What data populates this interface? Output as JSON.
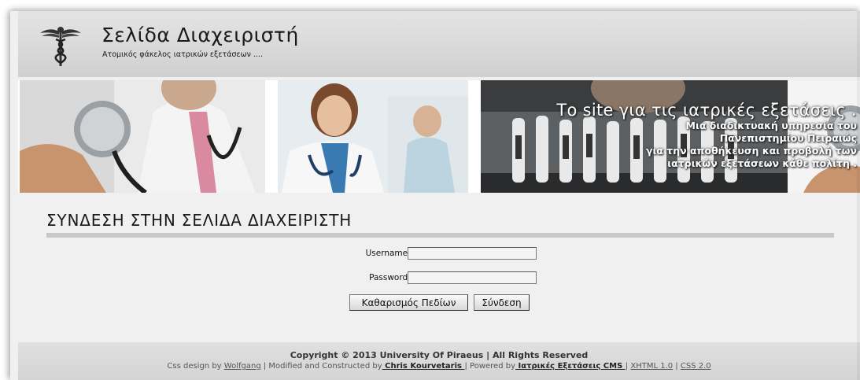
{
  "header": {
    "logo_icon": "caduceus-icon",
    "title": "Σελίδα Διαχειριστή",
    "subtitle": "Ατομικός φάκελος ιατρικών εξετάσεων ...."
  },
  "banner": {
    "title": "Το site για τις ιατρικές εξετάσεις .",
    "lines": [
      "Μια διαδικτυακή υπηρεσία του",
      "Πανεπιστημίου Πειραιώς",
      "για την αποθήκευση και προβολή των",
      "ιατρικών εξετάσεων κάθε πολίτη ."
    ]
  },
  "login": {
    "heading": "ΣΥΝΔΕΣΗ ΣΤΗΝ ΣΕΛΙΔΑ ΔΙΑΧΕΙΡΙΣΤΗ",
    "username_label": "Username :",
    "username_value": "",
    "password_label": "Password :",
    "password_value": "",
    "clear_button": "Καθαρισμός Πεδίων",
    "submit_button": "Σύνδεση"
  },
  "footer": {
    "copyright": "Copyright © 2013 University Of Piraeus | All Rights Reserved",
    "css_design_prefix": "Css design by ",
    "css_design_link": "Wolfgang",
    "modified_prefix": " | Modified and Constructed by",
    "modified_link": " Chris Kourvetaris ",
    "powered_prefix": "| Powered by",
    "powered_link": " Ιατρικές Εξετάσεις CMS ",
    "sep1": "| ",
    "xhtml_link": "XHTML 1.0",
    "sep2": " | ",
    "css_link": "CSS 2.0"
  }
}
